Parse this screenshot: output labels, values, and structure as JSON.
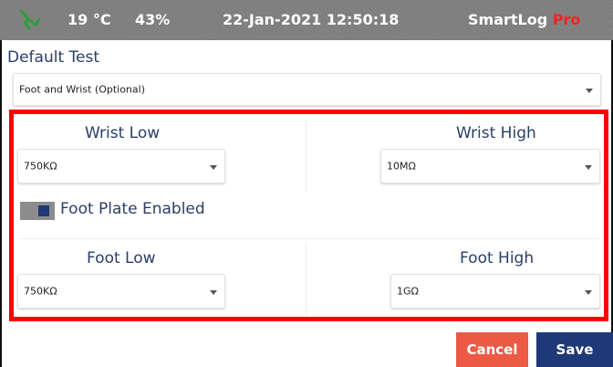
{
  "status": {
    "signal_icon": "antenna-signal-icon",
    "temperature": "19 °C",
    "humidity": "43%",
    "datetime": "22-Jan-2021 12:50:18",
    "brand": "SmartLog",
    "brand_suffix": "Pro"
  },
  "default_test": {
    "label": "Default Test",
    "selected": "Foot and Wrist (Optional)"
  },
  "wrist": {
    "low_label": "Wrist Low",
    "low_value": "750KΩ",
    "high_label": "Wrist High",
    "high_value": "10MΩ"
  },
  "foot_plate": {
    "label": "Foot Plate Enabled",
    "enabled": true
  },
  "foot": {
    "low_label": "Foot Low",
    "low_value": "750KΩ",
    "high_label": "Foot High",
    "high_value": "1GΩ"
  },
  "actions": {
    "cancel": "Cancel",
    "save": "Save"
  },
  "colors": {
    "accent": "#1f3978",
    "cancel": "#ec5a45",
    "highlight": "#ff0000",
    "brand_pro": "#ff2020"
  }
}
